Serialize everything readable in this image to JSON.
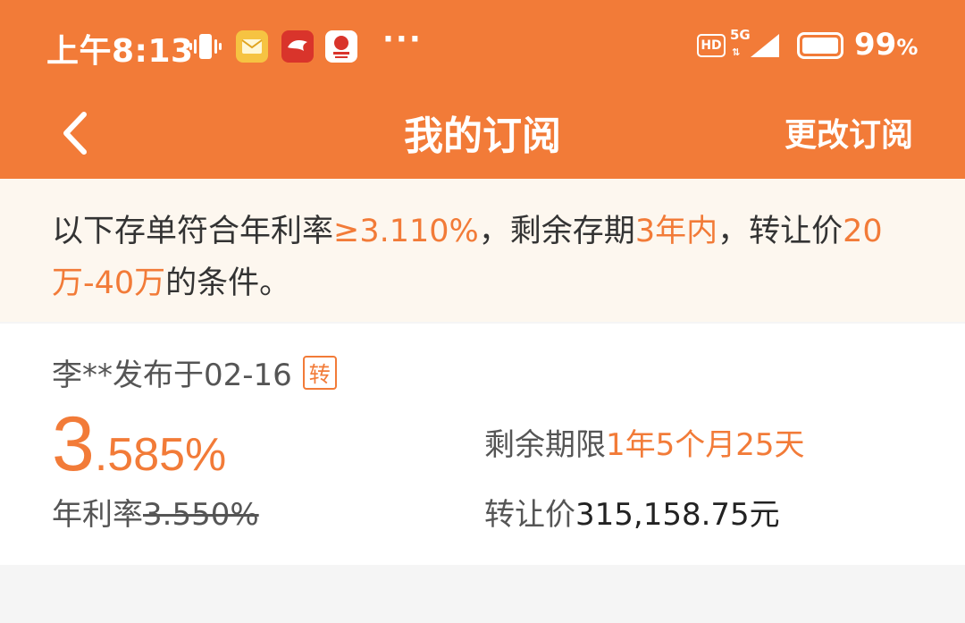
{
  "status_bar": {
    "time": "上午8:13",
    "network": "5G",
    "hd": "HD",
    "battery_percent": "99",
    "battery_suffix": "%",
    "battery_level": 0.99,
    "icons": [
      "vibrate-icon",
      "mail-app-icon",
      "red-app-icon",
      "bank-app-icon",
      "more-dots-icon",
      "hd-icon",
      "5g-icon",
      "signal-icon",
      "battery-icon"
    ]
  },
  "nav": {
    "title": "我的订阅",
    "action": "更改订阅"
  },
  "notice": {
    "prefix": "以下存单符合年利率",
    "rate": "≥3.110%",
    "sep1": "，剩余存期",
    "term": "3年内",
    "sep2": "，转让价",
    "price_range": "20万-40万",
    "suffix": "的条件。"
  },
  "listing": {
    "publisher": "李**发布于02-16",
    "tag": "转",
    "rate_int": "3",
    "rate_dec": ".585%",
    "rate_label": "年利率",
    "original_rate": "3.550%",
    "remaining_label": "剩余期限",
    "remaining_value": "1年5个月25天",
    "price_label": "转让价",
    "price_value": "315,158.75元"
  },
  "colors": {
    "accent": "#f27b38",
    "notice_bg": "#fdf7ef"
  }
}
